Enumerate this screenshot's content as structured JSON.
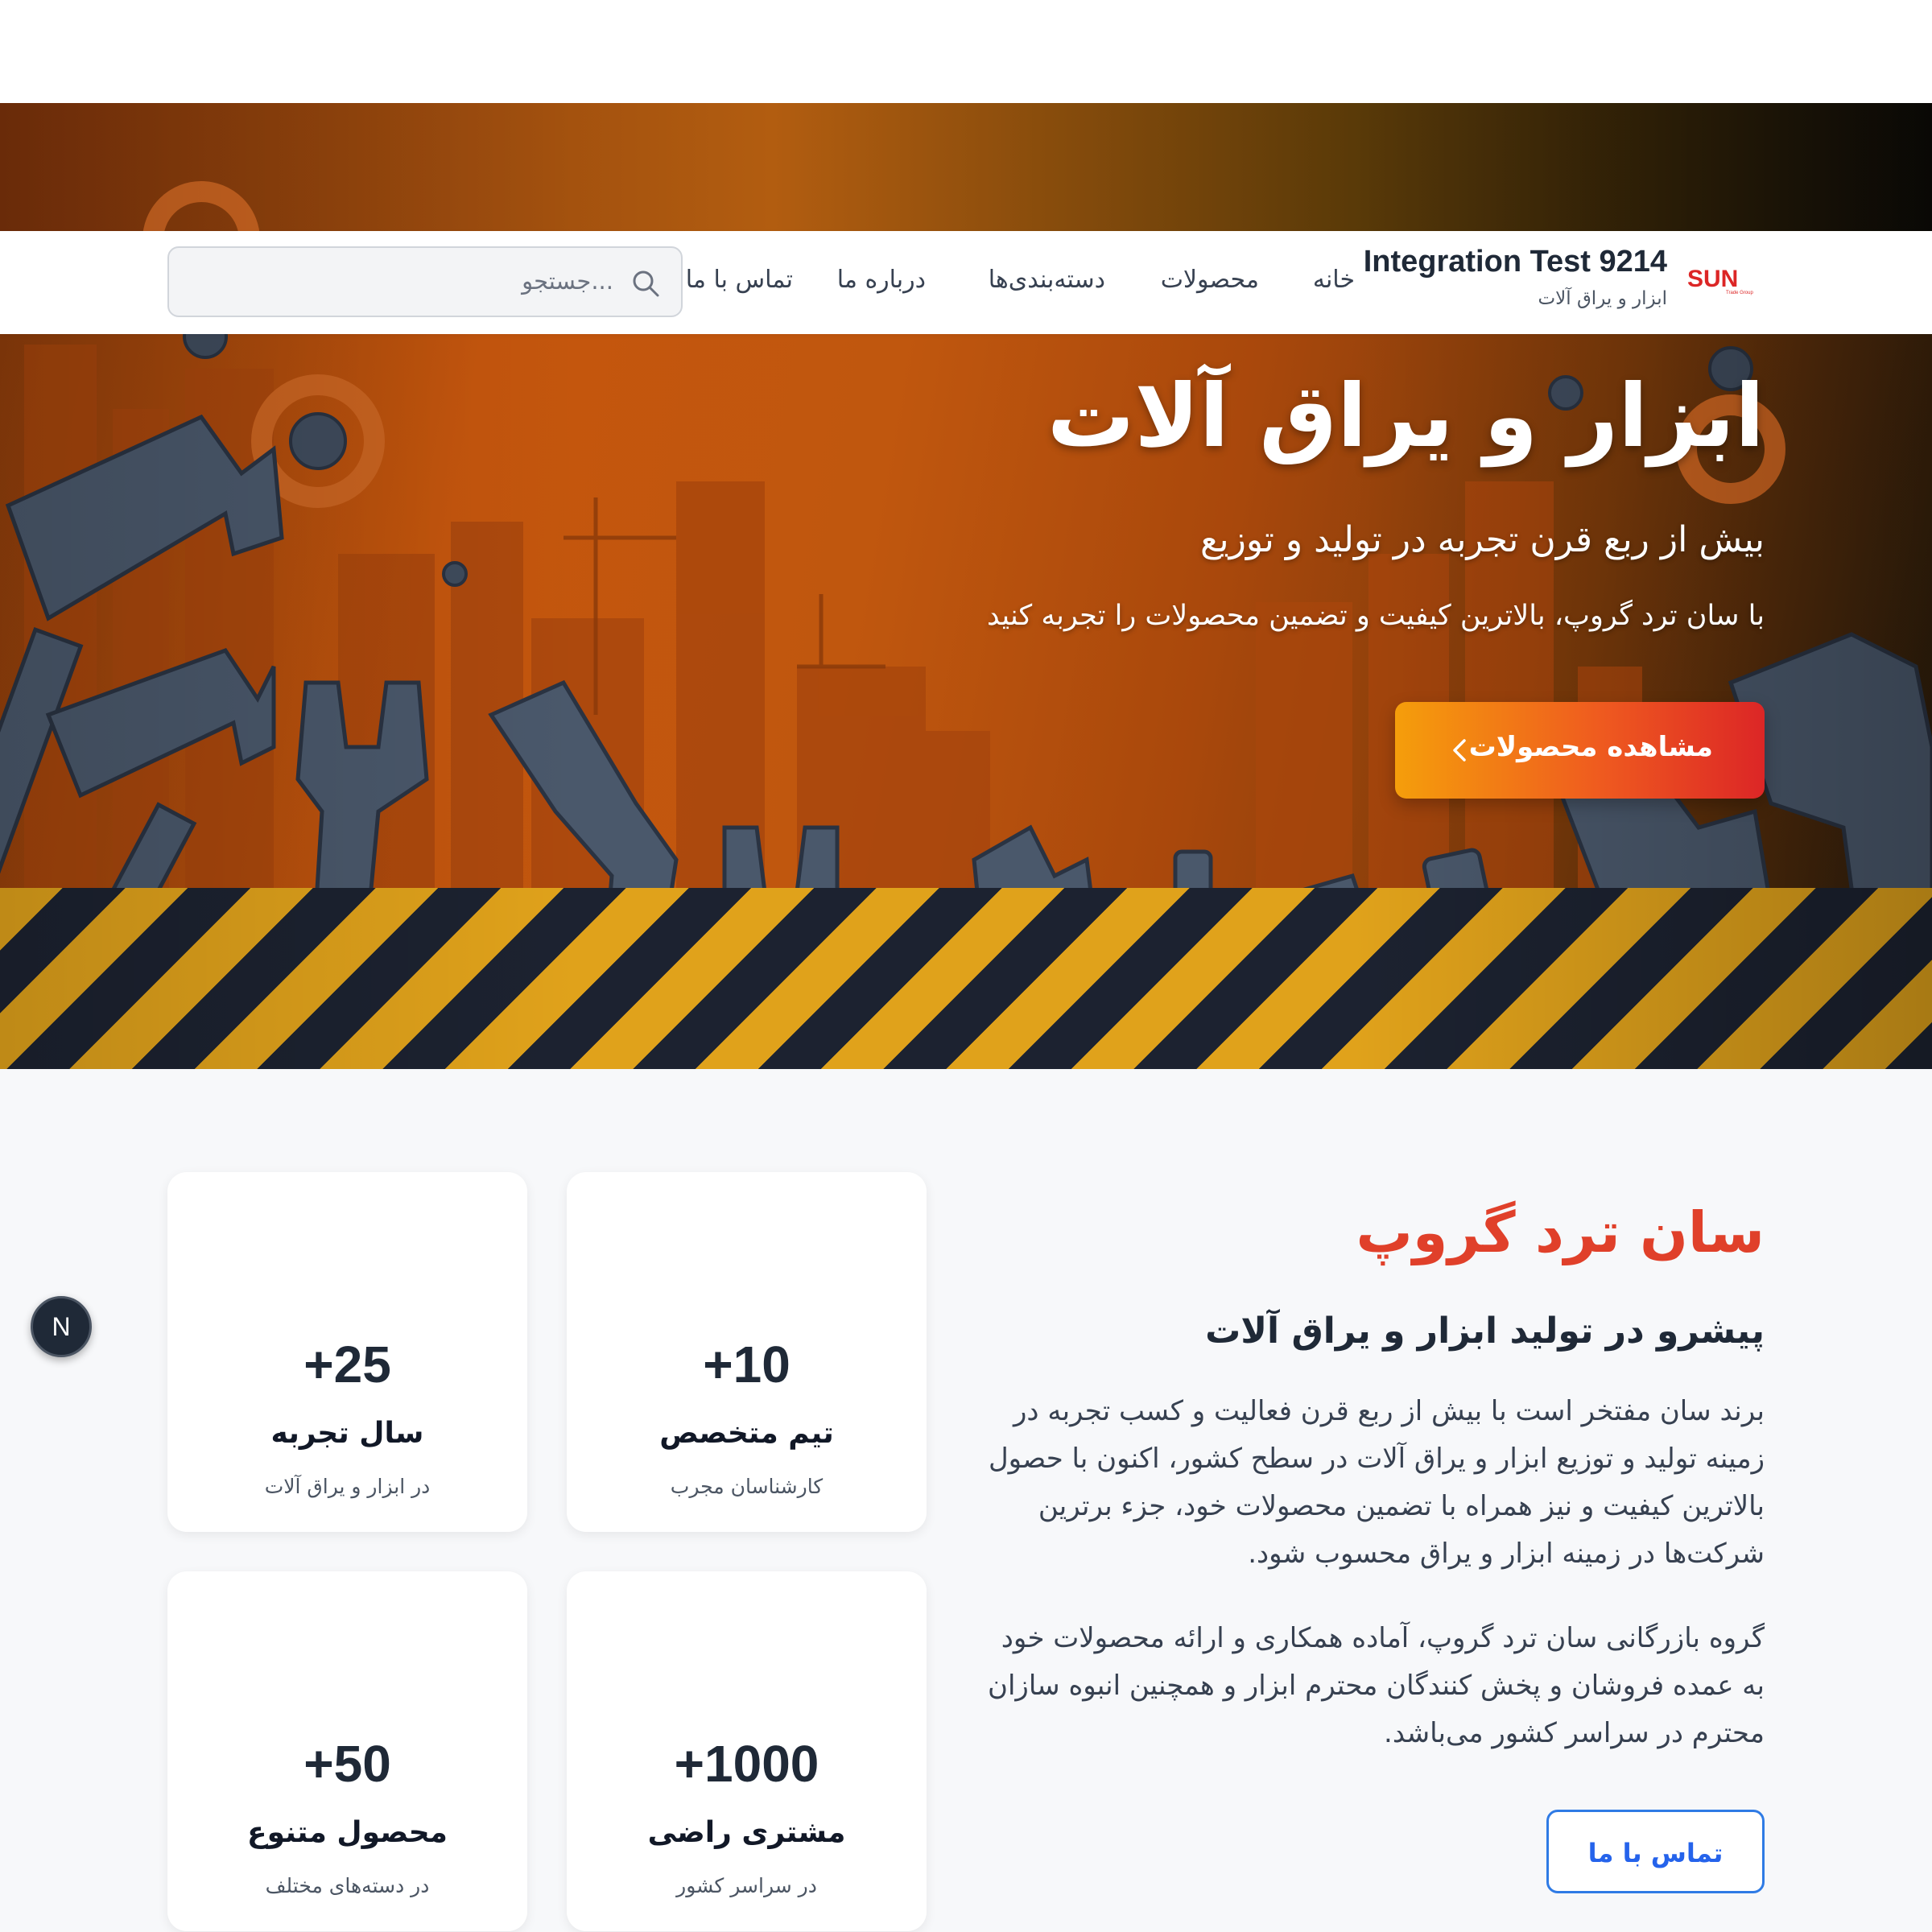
{
  "brand": {
    "logo_text": "SUN",
    "logo_tagline": "Trade Group",
    "title": "Integration Test 9214",
    "subtitle": "ابزار و یراق آلات"
  },
  "nav": {
    "items": [
      {
        "label": "خانه"
      },
      {
        "label": "محصولات"
      },
      {
        "label": "دسته‌بندی‌ها"
      },
      {
        "label": "درباره ما"
      },
      {
        "label": "تماس با ما"
      }
    ]
  },
  "search": {
    "placeholder": "جستجو..."
  },
  "hero": {
    "title": "ابزار و یراق آلات",
    "subtitle": "بیش از ربع قرن تجربه در تولید و توزیع",
    "description": "با سان ترد گروپ، بالاترین کیفیت و تضمین محصولات را تجربه کنید",
    "cta_label": "مشاهده محصولات"
  },
  "about": {
    "kicker": "سان ترد گروپ",
    "heading": "پیشرو در تولید ابزار و یراق آلات",
    "paragraph1": "برند سان مفتخر است با بیش از ربع قرن فعالیت و کسب تجربه در زمینه تولید و توزیع ابزار و یراق آلات در سطح کشور، اکنون با حصول بالاترین کیفیت و نیز همراه با تضمین محصولات خود، جزء برترین شرکت‌ها در زمینه ابزار و یراق محسوب شود.",
    "paragraph2": "گروه بازرگانی سان ترد گروپ، آماده همکاری و ارائه محصولات خود به عمده فروشان و پخش کنندگان محترم ابزار و همچنین انبوه سازان محترم در سراسر کشور می‌باشد.",
    "contact_label": "تماس با ما"
  },
  "stats": [
    {
      "value": "+10",
      "title": "تیم متخصص",
      "subtitle": "کارشناسان مجرب"
    },
    {
      "value": "+25",
      "title": "سال تجربه",
      "subtitle": "در ابزار و یراق آلات"
    },
    {
      "value": "+1000",
      "title": "مشتری راضی",
      "subtitle": "در سراسر کشور"
    },
    {
      "value": "+50",
      "title": "محصول متنوع",
      "subtitle": "در دسته‌های مختلف"
    }
  ],
  "floating_badge": "N",
  "colors": {
    "accent_orange": "#f59e0b",
    "accent_red": "#dc2626",
    "kicker_red": "#e0402a",
    "link_blue": "#2563eb"
  },
  "icons": {
    "search": "search-icon",
    "cta": "chevron-left-icon"
  }
}
